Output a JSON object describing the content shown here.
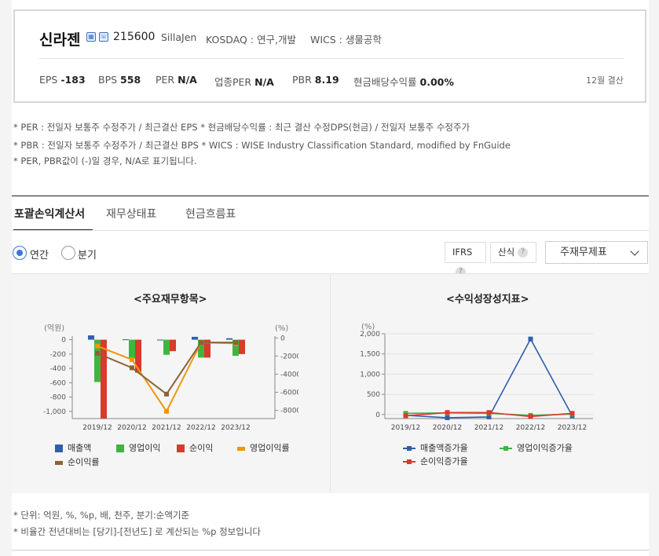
{
  "company": {
    "name": "신라젠",
    "code": "215600",
    "eng_name": "SillaJen",
    "market": "KOSDAQ : 연구,개발",
    "wics": "WICS : 생물공학",
    "icon1": "building-icon",
    "icon2": "phone-icon"
  },
  "metrics": {
    "eps_label": "EPS",
    "eps_value": "-183",
    "bps_label": "BPS",
    "bps_value": "558",
    "per_label": "PER",
    "per_value": "N/A",
    "ind_per_label": "업종PER",
    "ind_per_value": "N/A",
    "pbr_label": "PBR",
    "pbr_value": "8.19",
    "div_label": "현금배당수익률",
    "div_value": "0.00%",
    "fiscal": "12월 결산"
  },
  "notes": [
    "* PER : 전일자 보통주 수정주가 / 최근결산 EPS * 현금배당수익률 : 최근 결산 수정DPS(현금) / 전일자 보통주 수정주가",
    "* PBR : 전일자 보통주 수정주가 / 최근결산 BPS * WICS : WISE Industry Classification Standard, modified by FnGuide",
    "* PER, PBR값이 (-)일 경우, N/A로 표기됩니다."
  ],
  "tabs": [
    "포괄손익계산서",
    "재무상태표",
    "현금흐름표"
  ],
  "period": {
    "annual": "연간",
    "quarter": "분기"
  },
  "options": {
    "ifrs": "IFRS",
    "calc": "산식",
    "q": "?",
    "select": "주재무제표"
  },
  "chart_data": [
    {
      "type": "bar",
      "title": "<주요재무항목>",
      "ylabel_left": "(억원)",
      "ylabel_right": "(%)",
      "categories": [
        "2019/12",
        "2020/12",
        "2021/12",
        "2022/12",
        "2023/12"
      ],
      "ylim_left": [
        -1100,
        50
      ],
      "ylim_right": [
        -8900,
        200
      ],
      "left_ticks": [
        "0",
        "-200",
        "-400",
        "-600",
        "-800",
        "-1,000"
      ],
      "right_ticks": [
        "0",
        "-2000",
        "-4000",
        "-6000",
        "-8000"
      ],
      "series": [
        {
          "name": "매출액",
          "kind": "bar",
          "color": "#2f5fa8",
          "values": [
            60,
            5,
            1,
            40,
            20
          ]
        },
        {
          "name": "영업이익",
          "kind": "bar",
          "color": "#3fb53f",
          "values": [
            -590,
            -265,
            -210,
            -250,
            -225
          ]
        },
        {
          "name": "순이익",
          "kind": "bar",
          "color": "#d83a2b",
          "values": [
            -1100,
            -460,
            -160,
            -250,
            -200
          ]
        },
        {
          "name": "영업이익률",
          "kind": "line",
          "color": "#f0960a",
          "values": [
            -900,
            -2400,
            -8100,
            -500,
            -600
          ]
        },
        {
          "name": "순이익률",
          "kind": "line",
          "color": "#8c6239",
          "values": [
            -1700,
            -3300,
            -6200,
            -500,
            -500
          ]
        }
      ]
    },
    {
      "type": "line",
      "title": "<수익성장성지표>",
      "ylabel": "(%)",
      "categories": [
        "2019/12",
        "2020/12",
        "2021/12",
        "2022/12",
        "2023/12"
      ],
      "ylim": [
        -100,
        2000
      ],
      "ticks": [
        "2,000",
        "1,500",
        "1,000",
        "500",
        "0"
      ],
      "series": [
        {
          "name": "매출액증가율",
          "color": "#2f5fa8",
          "values": [
            -20,
            -80,
            -60,
            1870,
            -30
          ]
        },
        {
          "name": "영업이익증가율",
          "color": "#3fb53f",
          "values": [
            30,
            40,
            30,
            -20,
            10
          ]
        },
        {
          "name": "순이익증가율",
          "color": "#d83a2b",
          "values": [
            -30,
            50,
            50,
            -50,
            30
          ]
        }
      ]
    }
  ],
  "footnotes": [
    "* 단위: 억원, %, %p, 배, 천주, 분기:순액기준",
    "* 비율간 전년대비는 [당기]-[전년도] 로 계산되는 %p 정보입니다"
  ]
}
